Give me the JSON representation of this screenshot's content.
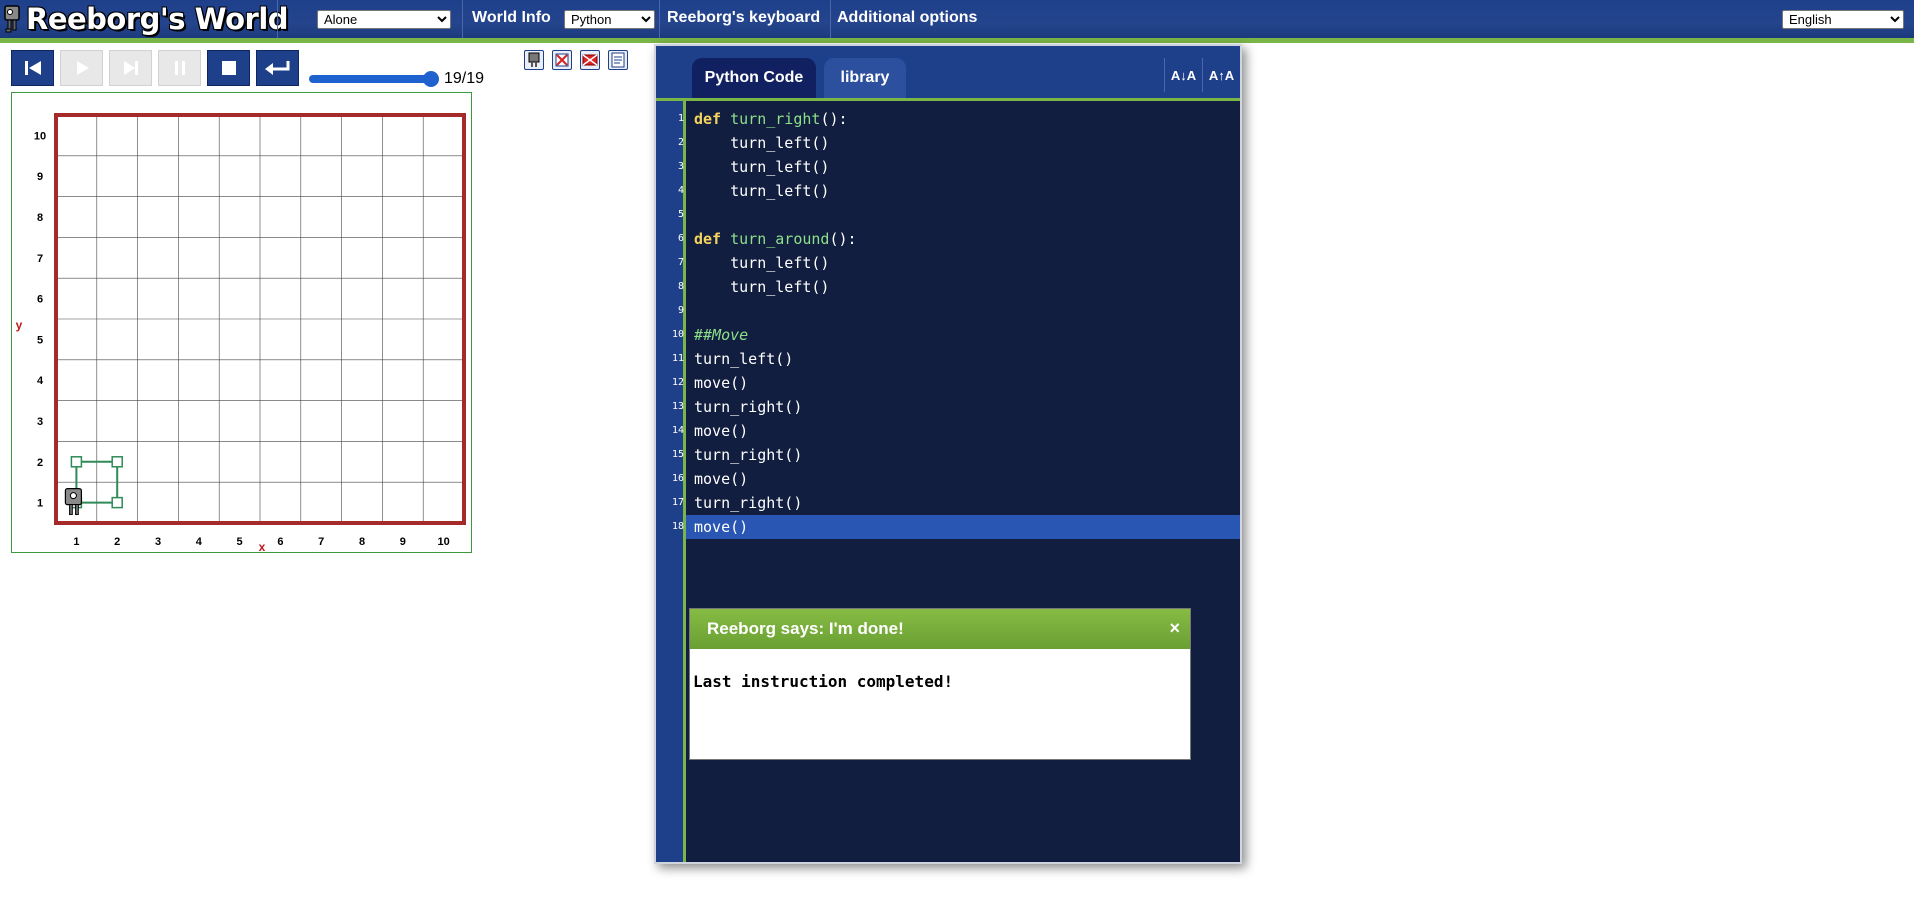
{
  "app": {
    "title": "Reeborg's World"
  },
  "topbar": {
    "world_select": "Alone",
    "world_info": "World Info",
    "language_select": "Python",
    "keyboard": "Reeborg's keyboard",
    "options": "Additional options",
    "ui_language": "English"
  },
  "controls": {
    "step_counter": "19/19",
    "slider_value": 19,
    "slider_max": 19
  },
  "world": {
    "x_label": "x",
    "y_label": "y",
    "x_ticks": [
      "1",
      "2",
      "3",
      "4",
      "5",
      "6",
      "7",
      "8",
      "9",
      "10"
    ],
    "y_ticks": [
      "1",
      "2",
      "3",
      "4",
      "5",
      "6",
      "7",
      "8",
      "9",
      "10"
    ],
    "robot_position": [
      1,
      1
    ],
    "trace_path": [
      [
        1,
        1
      ],
      [
        1,
        2
      ],
      [
        2,
        2
      ],
      [
        2,
        1
      ],
      [
        1,
        1
      ]
    ],
    "colors": {
      "wall": "#a52a2a",
      "trace": "#2e8b57",
      "grid": "#000000"
    }
  },
  "editor": {
    "tabs": [
      "Python Code",
      "library"
    ],
    "font_decrease": "A↓A",
    "font_increase": "A↑A",
    "highlight_line": 18
  },
  "code_lines": [
    [
      [
        "kw",
        "def"
      ],
      [
        "t",
        " "
      ],
      [
        "fn",
        "turn_right"
      ],
      [
        "t",
        "():"
      ]
    ],
    [
      [
        "t",
        "    turn_left()"
      ]
    ],
    [
      [
        "t",
        "    turn_left()"
      ]
    ],
    [
      [
        "t",
        "    turn_left()"
      ]
    ],
    [],
    [
      [
        "kw",
        "def"
      ],
      [
        "t",
        " "
      ],
      [
        "fn",
        "turn_around"
      ],
      [
        "t",
        "():"
      ]
    ],
    [
      [
        "t",
        "    turn_left()"
      ]
    ],
    [
      [
        "t",
        "    turn_left()"
      ]
    ],
    [],
    [
      [
        "cm",
        "##Move"
      ]
    ],
    [
      [
        "t",
        "turn_left()"
      ]
    ],
    [
      [
        "t",
        "move()"
      ]
    ],
    [
      [
        "t",
        "turn_right()"
      ]
    ],
    [
      [
        "t",
        "move()"
      ]
    ],
    [
      [
        "t",
        "turn_right()"
      ]
    ],
    [
      [
        "t",
        "move()"
      ]
    ],
    [
      [
        "t",
        "turn_right()"
      ]
    ],
    [
      [
        "t",
        "move()"
      ]
    ]
  ],
  "dialog": {
    "title": "Reeborg says: I'm done!",
    "close": "×",
    "message": "Last instruction completed!"
  }
}
